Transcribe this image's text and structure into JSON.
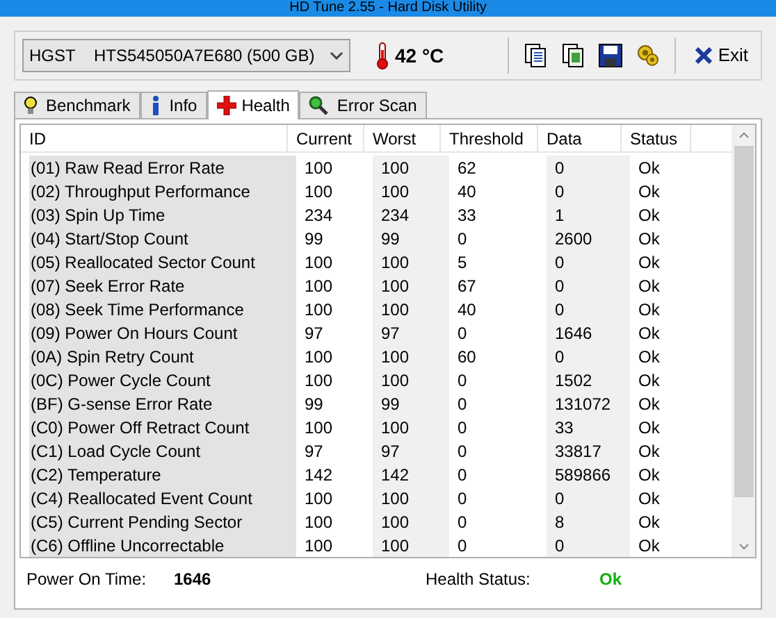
{
  "window": {
    "title": "HD Tune 2.55 - Hard Disk Utility"
  },
  "drive": {
    "value": "HGST    HTS545050A7E680 (500 GB)"
  },
  "temperature": "42 °C",
  "toolbar": [
    {
      "kind": "copy"
    },
    {
      "kind": "copy-all"
    },
    {
      "kind": "save"
    },
    {
      "kind": "options"
    }
  ],
  "exit_button": "Exit",
  "tabs": [
    {
      "label": "Benchmark",
      "kind": "benchmark",
      "selected": false
    },
    {
      "label": "Info",
      "kind": "info",
      "selected": false
    },
    {
      "label": "Health",
      "kind": "health",
      "selected": true
    },
    {
      "label": "Error Scan",
      "kind": "scan",
      "selected": false
    }
  ],
  "table": {
    "columns": [
      "ID",
      "Current",
      "Worst",
      "Threshold",
      "Data",
      "Status"
    ],
    "rows": [
      [
        "(01) Raw Read Error Rate",
        "100",
        "100",
        "62",
        "0",
        "Ok"
      ],
      [
        "(02) Throughput Performance",
        "100",
        "100",
        "40",
        "0",
        "Ok"
      ],
      [
        "(03) Spin Up Time",
        "234",
        "234",
        "33",
        "1",
        "Ok"
      ],
      [
        "(04) Start/Stop Count",
        "99",
        "99",
        "0",
        "2600",
        "Ok"
      ],
      [
        "(05) Reallocated Sector Count",
        "100",
        "100",
        "5",
        "0",
        "Ok"
      ],
      [
        "(07) Seek Error Rate",
        "100",
        "100",
        "67",
        "0",
        "Ok"
      ],
      [
        "(08) Seek Time Performance",
        "100",
        "100",
        "40",
        "0",
        "Ok"
      ],
      [
        "(09) Power On Hours Count",
        "97",
        "97",
        "0",
        "1646",
        "Ok"
      ],
      [
        "(0A) Spin Retry Count",
        "100",
        "100",
        "60",
        "0",
        "Ok"
      ],
      [
        "(0C) Power Cycle Count",
        "100",
        "100",
        "0",
        "1502",
        "Ok"
      ],
      [
        "(BF) G-sense Error Rate",
        "99",
        "99",
        "0",
        "131072",
        "Ok"
      ],
      [
        "(C0) Power Off Retract Count",
        "100",
        "100",
        "0",
        "33",
        "Ok"
      ],
      [
        "(C1) Load Cycle Count",
        "97",
        "97",
        "0",
        "33817",
        "Ok"
      ],
      [
        "(C2) Temperature",
        "142",
        "142",
        "0",
        "589866",
        "Ok"
      ],
      [
        "(C4) Reallocated Event Count",
        "100",
        "100",
        "0",
        "0",
        "Ok"
      ],
      [
        "(C5) Current Pending Sector",
        "100",
        "100",
        "0",
        "8",
        "Ok"
      ],
      [
        "(C6) Offline Uncorrectable",
        "100",
        "100",
        "0",
        "0",
        "Ok"
      ]
    ]
  },
  "summary": {
    "power_on_label": "Power On Time:",
    "power_on_value": "1646",
    "health_label": "Health Status:",
    "health_value": "Ok"
  }
}
